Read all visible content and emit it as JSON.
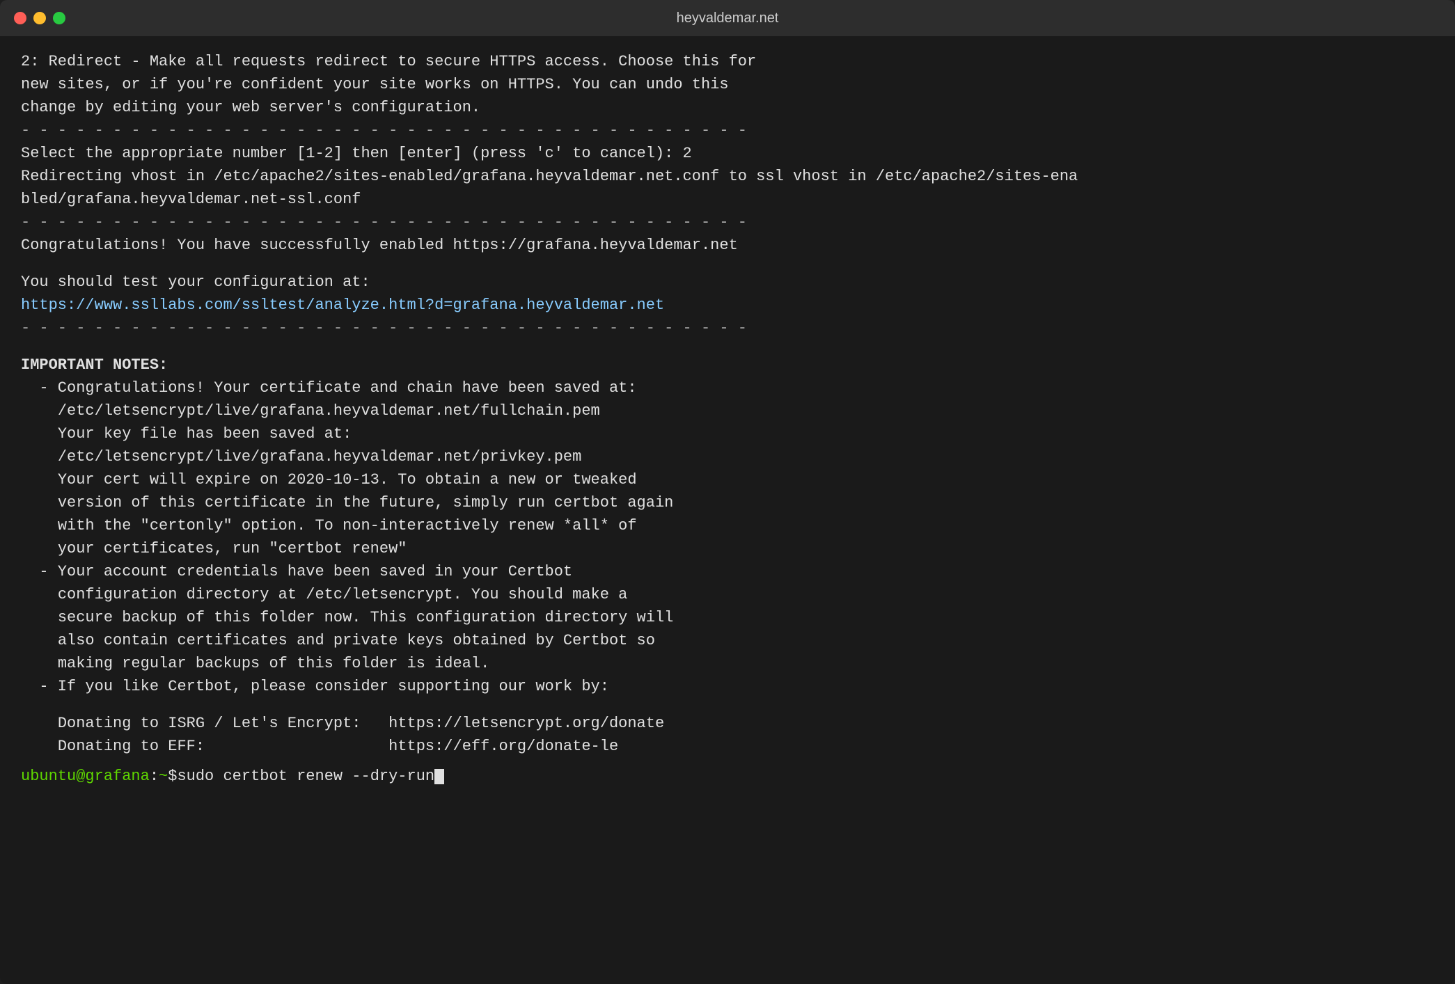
{
  "window": {
    "title": "heyvaldemar.net"
  },
  "traffic_lights": {
    "close_label": "close",
    "minimize_label": "minimize",
    "maximize_label": "maximize"
  },
  "content": {
    "line1": "2: Redirect - Make all requests redirect to secure HTTPS access. Choose this for",
    "line2": "new sites, or if you're confident your site works on HTTPS. You can undo this",
    "line3": "change by editing your web server's configuration.",
    "separator1": "- - - - - - - - - - - - - - - - - - - - - - - - - - - - - - - - - - - - - - - -",
    "line4": "Select the appropriate number [1-2] then [enter] (press 'c' to cancel): 2",
    "line5": "Redirecting vhost in /etc/apache2/sites-enabled/grafana.heyvaldemar.net.conf to ssl vhost in /etc/apache2/sites-ena",
    "line6": "bled/grafana.heyvaldemar.net-ssl.conf",
    "separator2": "- - - - - - - - - - - - - - - - - - - - - - - - - - - - - - - - - - - - - - - -",
    "line7": "Congratulations! You have successfully enabled https://grafana.heyvaldemar.net",
    "line8": "",
    "line9": "You should test your configuration at:",
    "line10_url": "https://www.ssllabs.com/ssltest/analyze.html?d=grafana.heyvaldemar.net",
    "separator3": "- - - - - - - - - - - - - - - - - - - - - - - - - - - - - - - - - - - - - - - -",
    "line11": "",
    "important_notes": "IMPORTANT NOTES:",
    "note1_a": "  - Congratulations! Your certificate and chain have been saved at:",
    "note1_b": "    /etc/letsencrypt/live/grafana.heyvaldemar.net/fullchain.pem",
    "note1_c": "    Your key file has been saved at:",
    "note1_d": "    /etc/letsencrypt/live/grafana.heyvaldemar.net/privkey.pem",
    "note1_e": "    Your cert will expire on 2020-10-13. To obtain a new or tweaked",
    "note1_f": "    version of this certificate in the future, simply run certbot again",
    "note1_g": "    with the \"certonly\" option. To non-interactively renew *all* of",
    "note1_h": "    your certificates, run \"certbot renew\"",
    "note2_a": "  - Your account credentials have been saved in your Certbot",
    "note2_b": "    configuration directory at /etc/letsencrypt. You should make a",
    "note2_c": "    secure backup of this folder now. This configuration directory will",
    "note2_d": "    also contain certificates and private keys obtained by Certbot so",
    "note2_e": "    making regular backups of this folder is ideal.",
    "note3_a": "  - If you like Certbot, please consider supporting our work by:",
    "note3_b": "",
    "note3_c": "    Donating to ISRG / Let's Encrypt:   https://letsencrypt.org/donate",
    "note3_d": "    Donating to EFF:                    https://eff.org/donate-le",
    "prompt_user": "ubuntu",
    "prompt_at": "@",
    "prompt_host": "grafana",
    "prompt_colon": ":",
    "prompt_path": "~",
    "prompt_symbol": "$",
    "prompt_command": " sudo certbot renew --dry-run"
  }
}
